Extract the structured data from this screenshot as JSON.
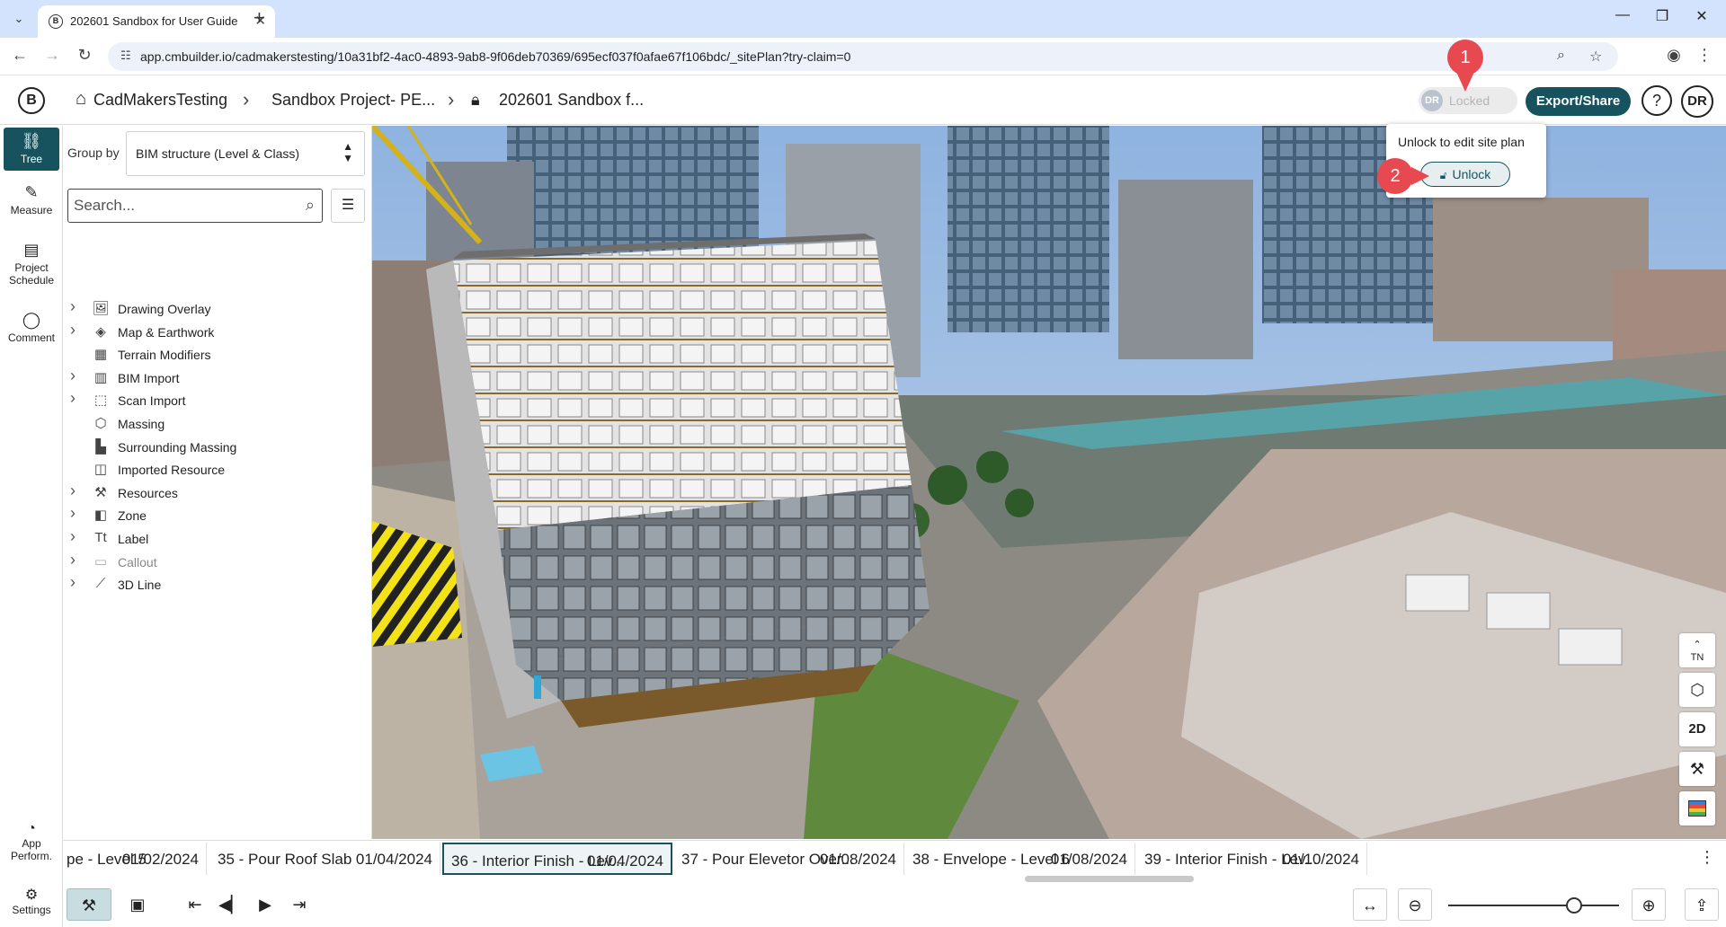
{
  "browser": {
    "tab_title": "202601 Sandbox for User Guide",
    "url": "app.cmbuilder.io/cadmakerstesting/10a31bf2-4ac0-4893-9ab8-9f06deb70369/695ecf037f0afae67f106bdc/_sitePlan?try-claim=0"
  },
  "header": {
    "breadcrumbs": [
      "CadMakersTesting",
      "Sandbox Project- PE...",
      "202601 Sandbox f..."
    ],
    "lock_avatar": "DR",
    "lock_status": "Locked",
    "export_label": "Export/Share",
    "help_label": "?",
    "user_initials": "DR"
  },
  "rail": {
    "items": [
      "Tree",
      "Measure",
      "Project Schedule",
      "Comment"
    ],
    "bottom_items": [
      "App Perform.",
      "Settings"
    ]
  },
  "panel": {
    "group_by_label": "Group by",
    "group_by_value": "BIM structure (Level & Class)",
    "search_placeholder": "Search...",
    "tree": [
      {
        "label": "Drawing Overlay",
        "expandable": true,
        "icon": "image-icon"
      },
      {
        "label": "Map & Earthwork",
        "expandable": true,
        "icon": "layers-icon"
      },
      {
        "label": "Terrain Modifiers",
        "expandable": false,
        "icon": "terrain-icon"
      },
      {
        "label": "BIM Import",
        "expandable": true,
        "icon": "building-icon"
      },
      {
        "label": "Scan Import",
        "expandable": true,
        "icon": "scan-icon"
      },
      {
        "label": "Massing",
        "expandable": false,
        "icon": "cube-icon"
      },
      {
        "label": "Surrounding Massing",
        "expandable": false,
        "icon": "buildings-icon"
      },
      {
        "label": "Imported Resource",
        "expandable": false,
        "icon": "box-icon"
      },
      {
        "label": "Resources",
        "expandable": true,
        "icon": "crane-icon"
      },
      {
        "label": "Zone",
        "expandable": true,
        "icon": "zone-icon"
      },
      {
        "label": "Label",
        "expandable": true,
        "icon": "text-icon"
      },
      {
        "label": "Callout",
        "expandable": true,
        "icon": "callout-icon",
        "dim": true
      },
      {
        "label": "3D Line",
        "expandable": true,
        "icon": "line-icon"
      }
    ]
  },
  "popover": {
    "text": "Unlock to edit site plan",
    "button": "Unlock",
    "marker_1": "1",
    "marker_2": "2"
  },
  "viewport_tools": [
    "TN",
    "cube",
    "2D",
    "crane",
    "palette"
  ],
  "timeline": [
    {
      "title": "pe - Level 5",
      "date": "01/02/2024"
    },
    {
      "title": "35 - Pour Roof Slab",
      "date": "01/04/2024"
    },
    {
      "title": "36 - Interior Finish - Lev...",
      "date": "01/04/2024",
      "active": true
    },
    {
      "title": "37 - Pour Elevetor Over...",
      "date": "01/08/2024"
    },
    {
      "title": "38 - Envelope - Level 6",
      "date": "01/08/2024"
    },
    {
      "title": "39 - Interior Finish - Lev...",
      "date": "01/10/2024"
    }
  ],
  "colors": {
    "accent": "#17535e",
    "marker": "#e64950"
  }
}
